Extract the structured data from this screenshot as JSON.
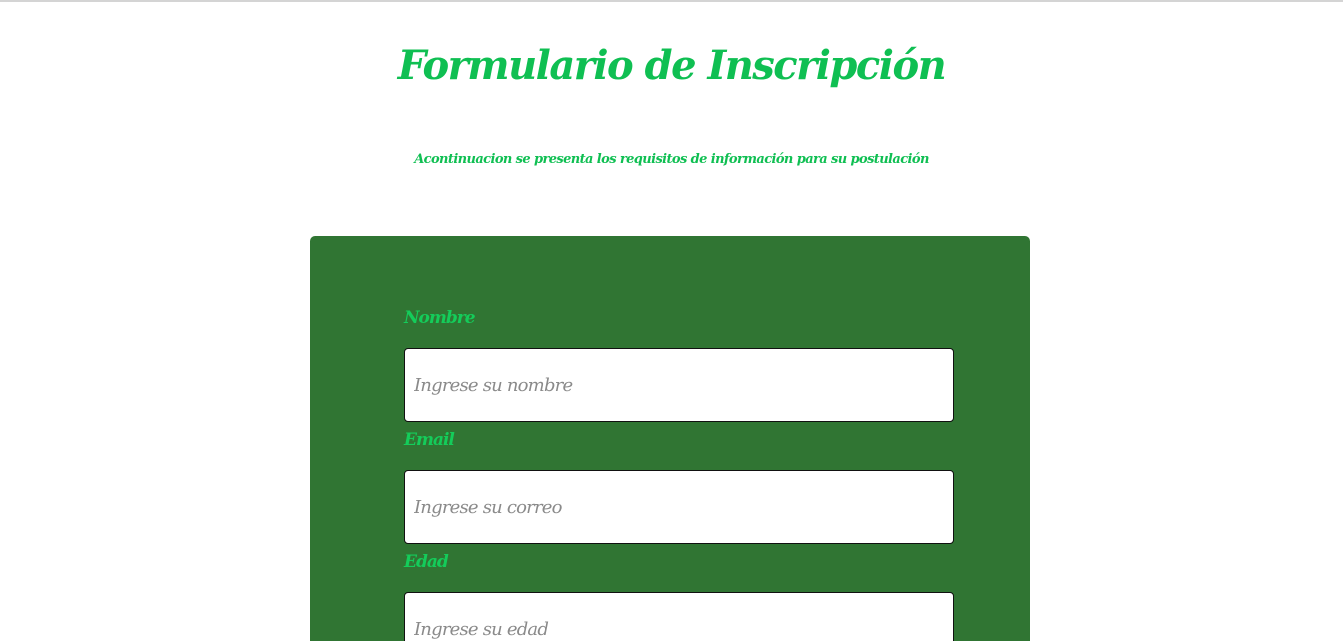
{
  "header": {
    "title": "Formulario de Inscripción",
    "subtitle": "Acontinuacion se presenta los requisitos de información para su postulación"
  },
  "form": {
    "fields": [
      {
        "label": "Nombre",
        "placeholder": "Ingrese su nombre",
        "value": ""
      },
      {
        "label": "Email",
        "placeholder": "Ingrese su correo",
        "value": ""
      },
      {
        "label": "Edad",
        "placeholder": "Ingrese su edad",
        "value": ""
      }
    ]
  },
  "colors": {
    "accent_green": "#0fbf52",
    "label_green": "#14cc5a",
    "card_background": "#307533",
    "page_background": "#ffffff"
  }
}
